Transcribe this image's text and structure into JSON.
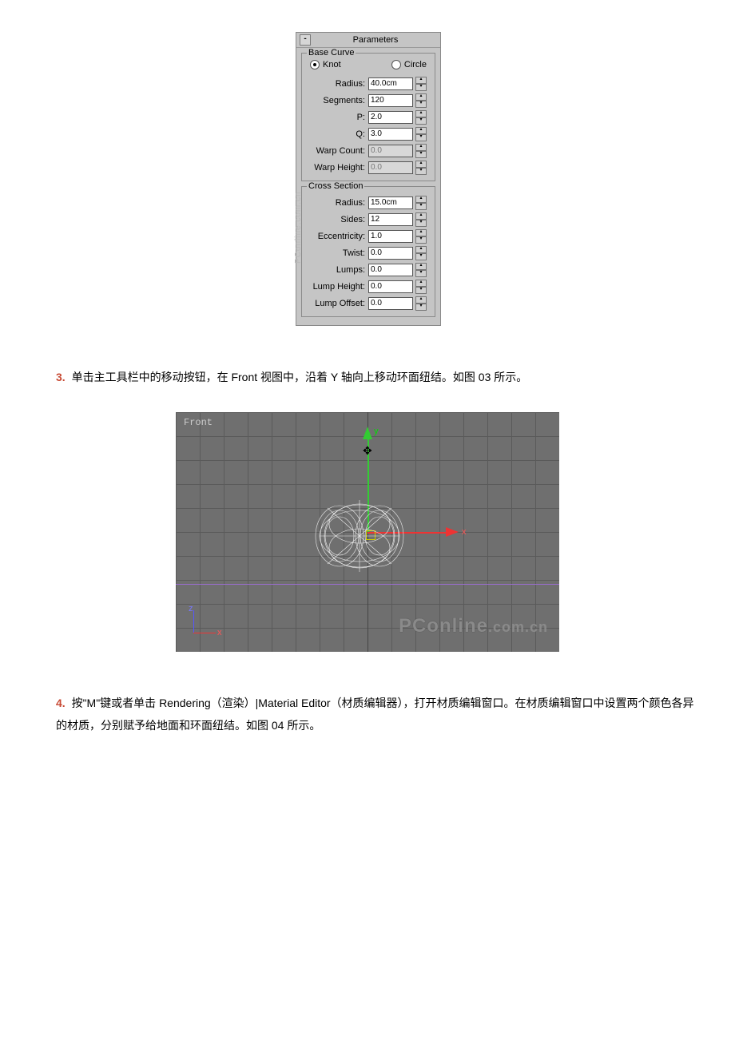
{
  "panel": {
    "title": "Parameters",
    "collapse_glyph": "-",
    "base_curve": {
      "legend": "Base Curve",
      "knot_label": "Knot",
      "circle_label": "Circle",
      "radius_label": "Radius:",
      "radius_value": "40.0cm",
      "segments_label": "Segments:",
      "segments_value": "120",
      "p_label": "P:",
      "p_value": "2.0",
      "q_label": "Q:",
      "q_value": "3.0",
      "warp_count_label": "Warp Count:",
      "warp_count_value": "0.0",
      "warp_height_label": "Warp Height:",
      "warp_height_value": "0.0"
    },
    "cross_section": {
      "legend": "Cross Section",
      "radius_label": "Radius:",
      "radius_value": "15.0cm",
      "sides_label": "Sides:",
      "sides_value": "12",
      "ecc_label": "Eccentricity:",
      "ecc_value": "1.0",
      "twist_label": "Twist:",
      "twist_value": "0.0",
      "lumps_label": "Lumps:",
      "lumps_value": "0.0",
      "lumph_label": "Lump Height:",
      "lumph_value": "0.0",
      "lumpo_label": "Lump Offset:",
      "lumpo_value": "0.0"
    }
  },
  "step3": {
    "num": "3.",
    "text": "单击主工具栏中的移动按钮，在 Front 视图中，沿着 Y 轴向上移动环面纽结。如图 03 所示。"
  },
  "viewport": {
    "label": "Front",
    "axis_x": "x",
    "axis_y": "y",
    "mini_z": "z",
    "mini_x": "x",
    "watermark_a": "PConline",
    "watermark_b": ".com.cn"
  },
  "step4": {
    "num": "4.",
    "text": "按\"M\"键或者单击 Rendering（渲染）|Material Editor（材质编辑器），打开材质编辑窗口。在材质编辑窗口中设置两个颜色各异的材质，分别赋予给地面和环面纽结。如图 04 所示。"
  },
  "glyphs": {
    "up": "▴",
    "down": "▾",
    "move": "✥"
  },
  "panel_watermark": "PConline.com.cn"
}
